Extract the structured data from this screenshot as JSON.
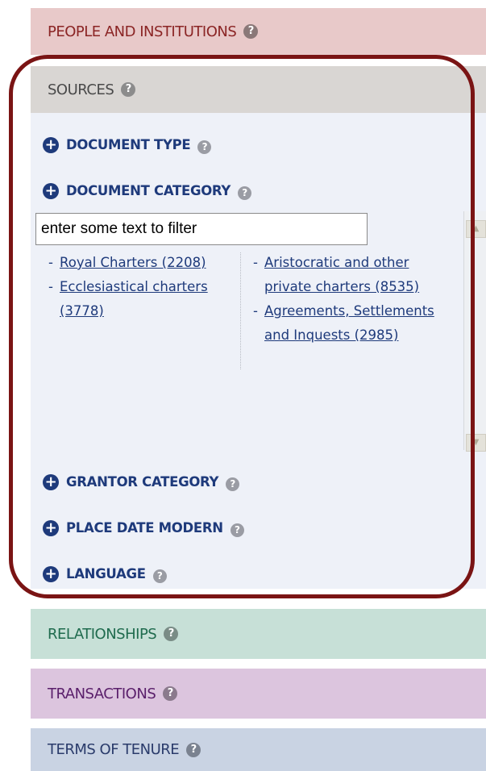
{
  "panels": {
    "people": "PEOPLE AND INSTITUTIONS",
    "sources": "SOURCES",
    "relationships": "RELATIONSHIPS",
    "transactions": "TRANSACTIONS",
    "tenure": "TERMS OF TENURE"
  },
  "help_glyph": "?",
  "facet_plus": "+",
  "sources": {
    "facets": {
      "document_type": "DOCUMENT TYPE",
      "document_category": "DOCUMENT CATEGORY",
      "grantor_category": "GRANTOR CATEGORY",
      "place_date_modern": "PLACE DATE MODERN",
      "language": "LANGUAGE"
    },
    "filter_placeholder": "enter some text to filter",
    "categories_left": [
      {
        "dash": "-",
        "label": "Royal Charters (2208)"
      },
      {
        "dash": "-",
        "label": "Ecclesiastical charters (3778)"
      }
    ],
    "categories_right": [
      {
        "dash": "-",
        "label": "Aristocratic and other private charters (8535)"
      },
      {
        "dash": "-",
        "label": "Agreements, Settlements and Inquests (2985)"
      }
    ]
  },
  "colors": {
    "frame": "#7a1414",
    "link": "#1e3a7b"
  }
}
